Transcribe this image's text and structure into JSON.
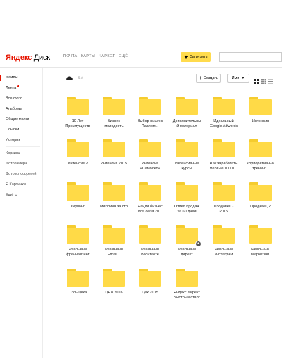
{
  "header": {
    "logo_ya": "Яндекс",
    "logo_disk": "Диск",
    "nav": [
      "ПОЧТА",
      "КАРТЫ",
      "ЧАРКЕТ",
      "ЕЩЁ"
    ],
    "upload_label": "Загрузить",
    "search_placeholder": ""
  },
  "sidebar": {
    "items": [
      "Файлы",
      "Лента",
      "Все фото",
      "Альбомы",
      "Общие папки",
      "Ссылки",
      "История"
    ],
    "items2": [
      "Корзина",
      "Фотокамера",
      "Фото из соцсетей",
      "Я.Картинки",
      "Ещё"
    ]
  },
  "toolbar": {
    "breadcrumb": "БМ",
    "create_label": "Создать",
    "sort_label": "Имя"
  },
  "folders": [
    {
      "name": "10 Лет\nПреимуществ"
    },
    {
      "name": "Бизнес\nмолодость"
    },
    {
      "name": "Выбор ниши с\nПавлом..."
    },
    {
      "name": "Дополнительны\nй материал"
    },
    {
      "name": "Идеальный\nGoogle Adwords"
    },
    {
      "name": "Интенсив"
    },
    {
      "name": "Интенсив 2"
    },
    {
      "name": "Интенсив 2015"
    },
    {
      "name": "Интенсив\n«Самолет»"
    },
    {
      "name": "Интенсивные\nкурсы"
    },
    {
      "name": "Как заработать\nпервые 100 0..."
    },
    {
      "name": "Корпоративный\nтренинг..."
    },
    {
      "name": "Коучинг"
    },
    {
      "name": "Миллион за сто"
    },
    {
      "name": "Найди бизнес\nдля себя 20..."
    },
    {
      "name": "Отдел продаж\nза 60 дней"
    },
    {
      "name": "Продавец -\n2015"
    },
    {
      "name": "Продавец 2"
    },
    {
      "name": "Реальный\nфранчайзинг"
    },
    {
      "name": "Реальный\nEmail..."
    },
    {
      "name": "Реальный\nВконтакте"
    },
    {
      "name": "Реальный\nдирект",
      "shared": true
    },
    {
      "name": "Реальный\nинстаграм"
    },
    {
      "name": "Реальный\nмаркетинг"
    },
    {
      "name": "Соль цеха"
    },
    {
      "name": "ЦЕХ 2016"
    },
    {
      "name": "Цех 2015"
    },
    {
      "name": "Яндекс Директ\nБыстрый старт"
    }
  ]
}
